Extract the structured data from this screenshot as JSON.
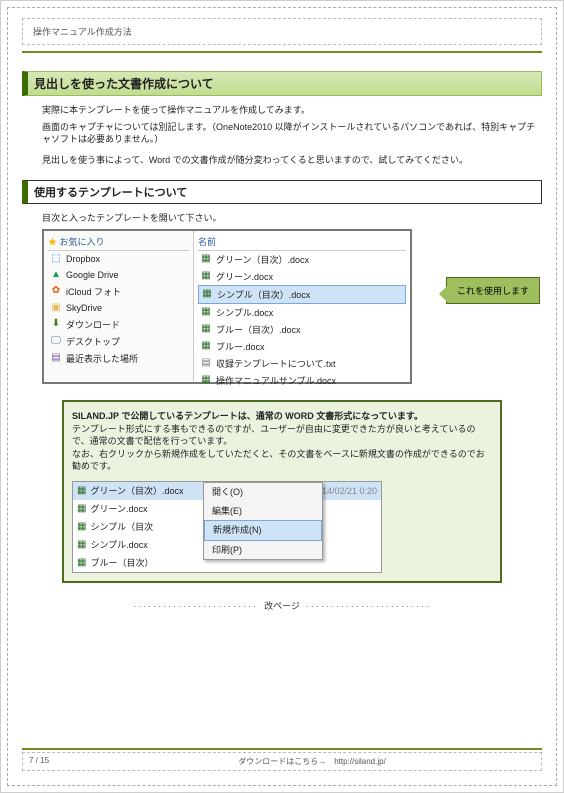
{
  "header": {
    "title": "操作マニュアル作成方法"
  },
  "h1": "見出しを使った文書作成について",
  "intro": [
    "実際に本テンプレートを使って操作マニュアルを作成してみます。",
    "画面のキャプチャについては別記します。（OneNote2010 以降がインストールされているパソコンであれば、特別キャプチャソフトは必要ありません。）",
    "見出しを使う事によって、Word での文書作成が随分変わってくると思いますので、試してみてください。"
  ],
  "h2": "使用するテンプレートについて",
  "instruction": "目次と入ったテンプレートを開いて下さい。",
  "favorites": {
    "left_header": "お気に入り",
    "right_header": "名前",
    "items": [
      {
        "icon": "dropbox-icon",
        "glyph": "⬚",
        "color": "#0061ff",
        "label": "Dropbox"
      },
      {
        "icon": "gdrive-icon",
        "glyph": "▲",
        "color": "#0f9d58",
        "label": "Google Drive"
      },
      {
        "icon": "icloud-icon",
        "glyph": "✿",
        "color": "#e85d00",
        "label": "iCloud フォト"
      },
      {
        "icon": "skydrive-icon",
        "glyph": "▣",
        "color": "#e6b84f",
        "label": "SkyDrive"
      },
      {
        "icon": "download-icon",
        "glyph": "⬇",
        "color": "#3b7a1f",
        "label": "ダウンロード"
      },
      {
        "icon": "desktop-icon",
        "glyph": "🖵",
        "color": "#4a7ab5",
        "label": "デスクトップ"
      },
      {
        "icon": "recent-icon",
        "glyph": "▤",
        "color": "#7a5aa5",
        "label": "最近表示した場所"
      }
    ],
    "files": [
      {
        "type": "doc",
        "name": "グリーン（目次）.docx",
        "selected": false
      },
      {
        "type": "doc",
        "name": "グリーン.docx",
        "selected": false
      },
      {
        "type": "doc",
        "name": "シンプル（目次）.docx",
        "selected": true
      },
      {
        "type": "doc",
        "name": "シンプル.docx",
        "selected": false
      },
      {
        "type": "doc",
        "name": "ブルー（目次）.docx",
        "selected": false
      },
      {
        "type": "doc",
        "name": "ブルー.docx",
        "selected": false
      },
      {
        "type": "txt",
        "name": "収録テンプレートについて.txt",
        "selected": false
      },
      {
        "type": "doc",
        "name": "操作マニュアルサンプル.docx",
        "selected": false
      }
    ],
    "callout": "これを使用します"
  },
  "infobox": {
    "line1a": "SILAND.JP で公開しているテンプレートは、通常の WORD 文書形式になっています。",
    "line2": "テンプレート形式にする事もできるのですが、ユーザーが自由に変更できた方が良いと考えているので、通常の文書で配信を行っています。",
    "line3": "なお、右クリックから新規作成をしていただくと、その文書をベースに新規文書の作成ができるのでお勧めです。"
  },
  "context": {
    "files": [
      {
        "name": "グリーン（目次）.docx",
        "selected": true,
        "date": "2014/02/21 0:20"
      },
      {
        "name": "グリーン.docx",
        "selected": false
      },
      {
        "name": "シンプル（目次",
        "selected": false
      },
      {
        "name": "シンプル.docx",
        "selected": false
      },
      {
        "name": "ブルー（目次）",
        "selected": false
      }
    ],
    "menu": [
      {
        "label": "開く(O)",
        "hl": false
      },
      {
        "label": "編集(E)",
        "hl": false
      },
      {
        "label": "新規作成(N)",
        "hl": true
      },
      {
        "label": "印刷(P)",
        "hl": false
      }
    ]
  },
  "pagebreak": "改ページ",
  "footer": {
    "page": "7 / 15",
    "download": "ダウンロードはこちら→　http://siland.jp/"
  }
}
